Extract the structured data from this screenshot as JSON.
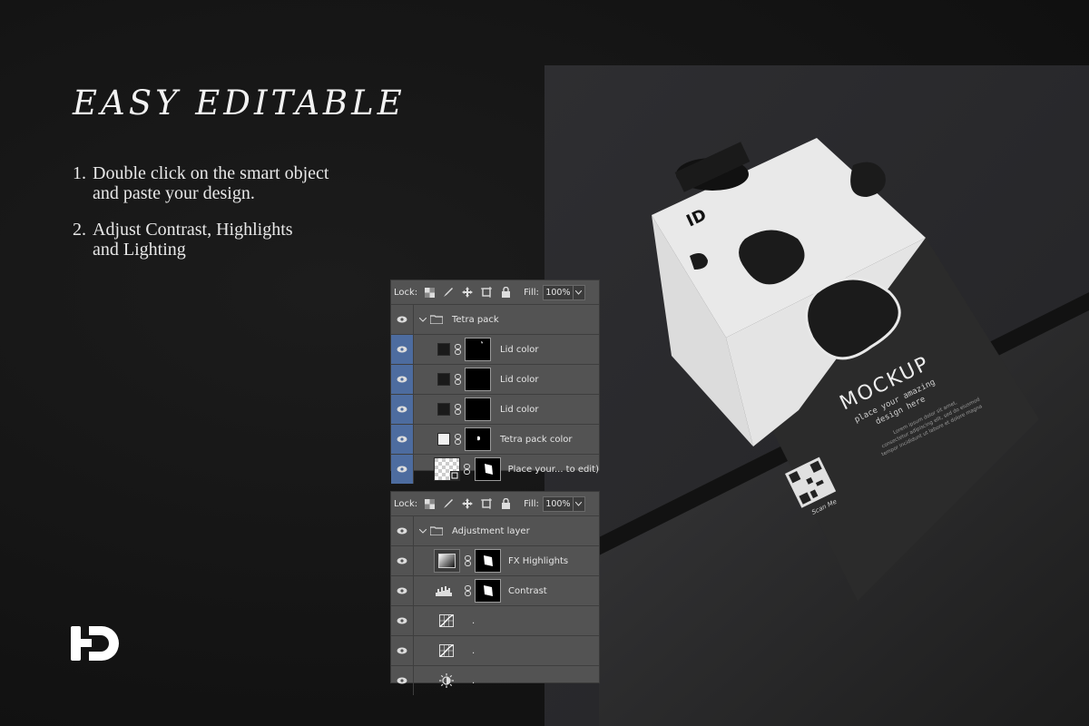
{
  "headline": "EASY EDITABLE",
  "steps": [
    {
      "num": "1.",
      "text": "Double click on the smart object\nand paste your design."
    },
    {
      "num": "2.",
      "text": "Adjust Contrast, Highlights\nand Lighting"
    }
  ],
  "pack": {
    "title": "MOCKUP",
    "subtitle": "place your amazing\ndesign here",
    "body": "Lorem ipsum dolor sit amet,\nconsectetur adipiscing elit, sed do eiusmod\ntempor incididunt ut labore et dolore magna",
    "scan": "Scan Me"
  },
  "panel1": {
    "lock_label": "Lock:",
    "fill_label": "Fill:",
    "fill_value": "100%",
    "group_name": "Tetra pack",
    "layers": [
      {
        "name": "Lid color",
        "thumb": "#1a1a1a",
        "selected": true
      },
      {
        "name": "Lid color",
        "thumb": "#1a1a1a",
        "selected": true
      },
      {
        "name": "Lid color",
        "thumb": "#1a1a1a",
        "selected": true
      },
      {
        "name": "Tetra pack color",
        "thumb": "#f2f2f2",
        "selected": true
      },
      {
        "name": "Place your... to edit)",
        "thumb": "smart",
        "selected": true
      }
    ]
  },
  "panel2": {
    "lock_label": "Lock:",
    "fill_label": "Fill:",
    "fill_value": "100%",
    "group_name": "Adjustment layer",
    "layers": [
      {
        "name": "FX Highlights",
        "icon": "gradient-icon"
      },
      {
        "name": "Contrast",
        "icon": "levels-icon"
      },
      {
        "name": ".",
        "icon": "curves-icon"
      },
      {
        "name": ".",
        "icon": "curves-icon"
      },
      {
        "name": ".",
        "icon": "brightness-icon"
      }
    ]
  },
  "colors": {
    "panel_bg": "#535353",
    "selection": "#4d6c9f",
    "page_bg": "#151515"
  }
}
